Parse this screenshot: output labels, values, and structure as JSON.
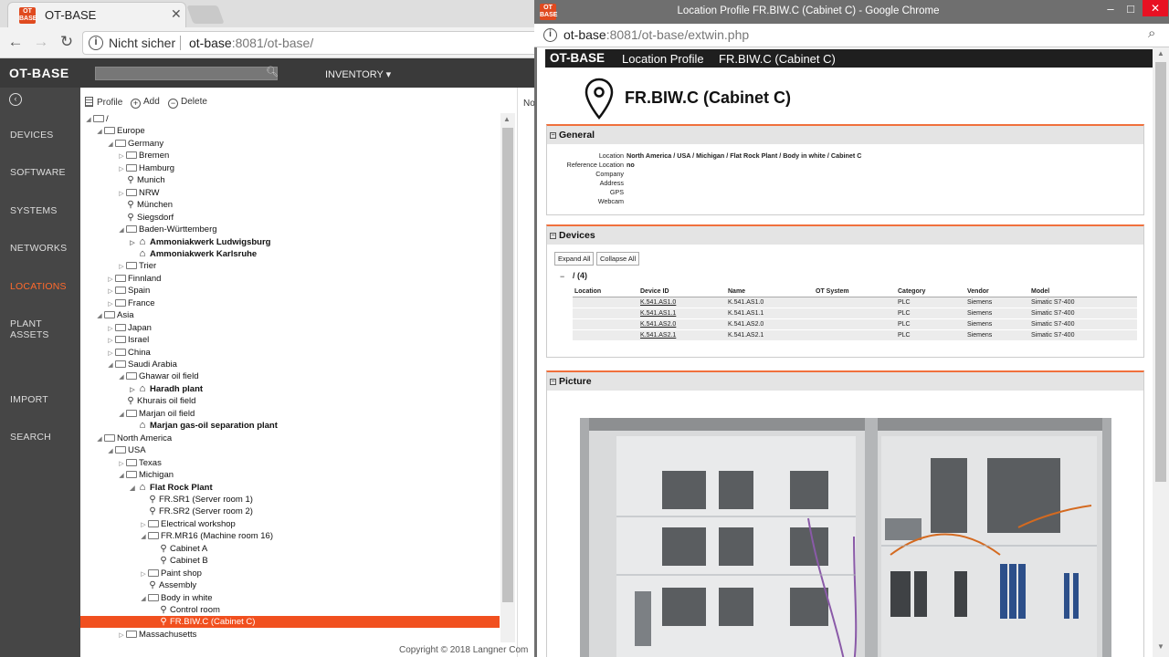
{
  "left_browser": {
    "tab_title": "OT-BASE",
    "favicon_text": "OT BASE",
    "security_text": "Nicht sicher",
    "url_host": "ot-base",
    "url_port_path": ":8081/ot-base/"
  },
  "app": {
    "logo": "OT-BASE",
    "menu": "INVENTORY ▾",
    "sidebar": [
      "DEVICES",
      "SOFTWARE",
      "SYSTEMS",
      "NETWORKS",
      "LOCATIONS",
      "PLANT ASSETS",
      "IMPORT",
      "SEARCH"
    ],
    "active_sidebar": "LOCATIONS",
    "toolbar": {
      "profile": "Profile",
      "add": "Add",
      "delete": "Delete"
    },
    "right_pane_text": "No",
    "copyright": "Copyright © 2018 Langner Com"
  },
  "tree": [
    {
      "label": "/",
      "level": 0,
      "type": "folder",
      "state": "open"
    },
    {
      "label": "Europe",
      "level": 1,
      "type": "folder",
      "state": "open"
    },
    {
      "label": "Germany",
      "level": 2,
      "type": "folder",
      "state": "open"
    },
    {
      "label": "Bremen",
      "level": 3,
      "type": "folder",
      "state": "closed"
    },
    {
      "label": "Hamburg",
      "level": 3,
      "type": "folder",
      "state": "closed"
    },
    {
      "label": "Munich",
      "level": 3,
      "type": "pin"
    },
    {
      "label": "NRW",
      "level": 3,
      "type": "folder",
      "state": "closed"
    },
    {
      "label": "München",
      "level": 3,
      "type": "pin"
    },
    {
      "label": "Siegsdorf",
      "level": 3,
      "type": "pin"
    },
    {
      "label": "Baden-Württemberg",
      "level": 3,
      "type": "folder",
      "state": "open"
    },
    {
      "label": "Ammoniakwerk Ludwigsburg",
      "level": 4,
      "type": "plant",
      "state": "closed",
      "bold": true
    },
    {
      "label": "Ammoniakwerk Karlsruhe",
      "level": 4,
      "type": "plant",
      "bold": true
    },
    {
      "label": "Trier",
      "level": 3,
      "type": "folder",
      "state": "closed"
    },
    {
      "label": "Finnland",
      "level": 2,
      "type": "folder",
      "state": "closed"
    },
    {
      "label": "Spain",
      "level": 2,
      "type": "folder",
      "state": "closed"
    },
    {
      "label": "France",
      "level": 2,
      "type": "folder",
      "state": "closed"
    },
    {
      "label": "Asia",
      "level": 1,
      "type": "folder",
      "state": "open"
    },
    {
      "label": "Japan",
      "level": 2,
      "type": "folder",
      "state": "closed"
    },
    {
      "label": "Israel",
      "level": 2,
      "type": "folder",
      "state": "closed"
    },
    {
      "label": "China",
      "level": 2,
      "type": "folder",
      "state": "closed"
    },
    {
      "label": "Saudi Arabia",
      "level": 2,
      "type": "folder",
      "state": "open"
    },
    {
      "label": "Ghawar oil field",
      "level": 3,
      "type": "folder",
      "state": "open"
    },
    {
      "label": "Haradh plant",
      "level": 4,
      "type": "plant",
      "state": "closed",
      "bold": true
    },
    {
      "label": "Khurais oil field",
      "level": 3,
      "type": "pin"
    },
    {
      "label": "Marjan oil field",
      "level": 3,
      "type": "folder",
      "state": "open"
    },
    {
      "label": "Marjan gas-oil separation plant",
      "level": 4,
      "type": "plant",
      "bold": true
    },
    {
      "label": "North America",
      "level": 1,
      "type": "folder",
      "state": "open"
    },
    {
      "label": "USA",
      "level": 2,
      "type": "folder",
      "state": "open"
    },
    {
      "label": "Texas",
      "level": 3,
      "type": "folder",
      "state": "closed"
    },
    {
      "label": "Michigan",
      "level": 3,
      "type": "folder",
      "state": "open"
    },
    {
      "label": "Flat Rock Plant",
      "level": 4,
      "type": "plant",
      "state": "open",
      "bold": true
    },
    {
      "label": "FR.SR1 (Server room 1)",
      "level": 5,
      "type": "pin"
    },
    {
      "label": "FR.SR2 (Server room 2)",
      "level": 5,
      "type": "pin"
    },
    {
      "label": "Electrical workshop",
      "level": 5,
      "type": "folder",
      "state": "closed"
    },
    {
      "label": "FR.MR16 (Machine room 16)",
      "level": 5,
      "type": "folder",
      "state": "open"
    },
    {
      "label": "Cabinet A",
      "level": 6,
      "type": "pin"
    },
    {
      "label": "Cabinet B",
      "level": 6,
      "type": "pin"
    },
    {
      "label": "Paint shop",
      "level": 5,
      "type": "folder",
      "state": "closed"
    },
    {
      "label": "Assembly",
      "level": 5,
      "type": "pin"
    },
    {
      "label": "Body in white",
      "level": 5,
      "type": "folder",
      "state": "open"
    },
    {
      "label": "Control room",
      "level": 6,
      "type": "pin"
    },
    {
      "label": "FR.BIW.C (Cabinet C)",
      "level": 6,
      "type": "pin",
      "selected": true
    },
    {
      "label": "Massachusetts",
      "level": 3,
      "type": "folder",
      "state": "closed"
    }
  ],
  "right_browser": {
    "title": "Location Profile FR.BIW.C (Cabinet C) - Google Chrome",
    "url_host": "ot-base",
    "url_port_path": ":8081/ot-base/extwin.php"
  },
  "profile": {
    "logo": "OT-BASE",
    "header_title": "Location Profile",
    "header_id": "FR.BIW.C (Cabinet C)",
    "name": "FR.BIW.C (Cabinet C)",
    "general_title": "General",
    "general": [
      {
        "key": "Location",
        "value": "North America / USA / Michigan / Flat Rock Plant / Body in white / Cabinet C"
      },
      {
        "key": "Reference Location",
        "value": "no"
      },
      {
        "key": "Company",
        "value": ""
      },
      {
        "key": "Address",
        "value": ""
      },
      {
        "key": "GPS",
        "value": ""
      },
      {
        "key": "Webcam",
        "value": ""
      }
    ],
    "devices_title": "Devices",
    "expand_all": "Expand All",
    "collapse_all": "Collapse All",
    "group_label": "/ (4)",
    "columns": [
      "Location",
      "Device ID",
      "Name",
      "OT System",
      "Category",
      "Vendor",
      "Model"
    ],
    "rows": [
      [
        "",
        "K.541.AS1.0",
        "K.541.AS1.0",
        "",
        "PLC",
        "Siemens",
        "Simatic S7-400"
      ],
      [
        "",
        "K.541.AS1.1",
        "K.541.AS1.1",
        "",
        "PLC",
        "Siemens",
        "Simatic S7-400"
      ],
      [
        "",
        "K.541.AS2.0",
        "K.541.AS2.0",
        "",
        "PLC",
        "Siemens",
        "Simatic S7-400"
      ],
      [
        "",
        "K.541.AS2.1",
        "K.541.AS2.1",
        "",
        "PLC",
        "Siemens",
        "Simatic S7-400"
      ]
    ],
    "picture_title": "Picture"
  },
  "colors": {
    "accent": "#f1501f",
    "sidebar": "#464646",
    "header": "#1f1f1f"
  }
}
